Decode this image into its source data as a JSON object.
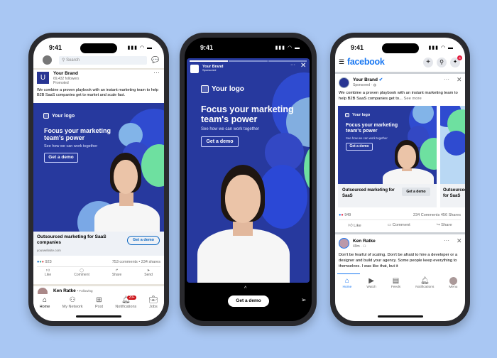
{
  "status_time": "9:41",
  "creative": {
    "logo": "Your logo",
    "headline": "Focus your marketing team's power",
    "sub": "See how we can work together",
    "cta": "Get a demo"
  },
  "linkedin": {
    "search_placeholder": "Search",
    "brand": "Your Brand",
    "followers": "69,432 followers",
    "promoted": "Promoted",
    "body": "We combine a proven playbook with an instant marketing team to help B2B SaaS companies get to market and scale fast.",
    "caption": "Outsourced marketing for SaaS companies",
    "url": "yourwebsite.com",
    "cta": "Get a demo",
    "reactions": "923",
    "comments": "753 comments",
    "shares": "234 shares",
    "dot": "•",
    "actions": [
      "Like",
      "Comment",
      "Share",
      "Send"
    ],
    "next_author": "Ken Ratke",
    "following": "• Following",
    "nav": [
      "Home",
      "My Network",
      "Post",
      "Notifications",
      "Jobs"
    ],
    "notif_badge": "20+"
  },
  "story": {
    "brand": "Your Brand",
    "sponsored": "Sponsored",
    "cta": "Get a demo"
  },
  "facebook": {
    "logo": "facebook",
    "messenger_badge": "4",
    "brand": "Your Brand",
    "sponsored": "Sponsored ·",
    "body": "We combine a proven playbook with an instant marketing team to help B2B SaaS companies get to...",
    "see_more": "See more",
    "cards": [
      {
        "caption": "Outsourced marketing for SaaS",
        "cta": "Get a demo"
      },
      {
        "caption": "Outsourced marketing for SaaS"
      }
    ],
    "reactions": "949",
    "comments": "234 Comments",
    "shares": "456 Shares",
    "actions": [
      "Like",
      "Comment",
      "Share"
    ],
    "next_author": "Ken Ratke",
    "next_time": "49m ·",
    "next_body": "Don't be fearful of scaling. Don't be afraid to hire a developer or a designer and build your agency. Some people keep everything to themselves. I was like that, but it",
    "nav": [
      "Home",
      "Watch",
      "Feeds",
      "Notifications",
      "Menu"
    ]
  }
}
